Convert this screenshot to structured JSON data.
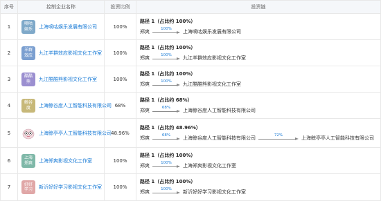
{
  "headers": {
    "index": "序号",
    "company": "控制企业名称",
    "ratio": "投资比例",
    "chain": "投资链"
  },
  "rows": [
    {
      "index": "1",
      "logo_text": "嘀咕\n娱乐",
      "logo_color": "#7fa9c9",
      "company": "上海嘀咕娱乐发展有限公司",
      "ratio": "100%",
      "path_title": "路径 1（占比约 100%）",
      "chain": [
        {
          "node": "郑爽"
        },
        {
          "pct": "100%"
        },
        {
          "node": "上海嘀咕娱乐发展有限公司"
        }
      ]
    },
    {
      "index": "2",
      "logo_text": "羊群\n效应",
      "logo_color": "#7b9fd0",
      "company": "九江羊群效应影视文化工作室",
      "ratio": "100%",
      "path_title": "路径 1（占比约 100%）",
      "chain": [
        {
          "node": "郑爽"
        },
        {
          "pct": "100%"
        },
        {
          "node": "九江羊群效应影视文化工作室"
        }
      ]
    },
    {
      "index": "3",
      "logo_text": "酷酷\n熊",
      "logo_color": "#9b8fd0",
      "company": "九江酷酷熊影视文化工作室",
      "ratio": "100%",
      "path_title": "路径 1（占比约 100%）",
      "chain": [
        {
          "node": "郑爽"
        },
        {
          "pct": "100%"
        },
        {
          "node": "九江酷酷熊影视文化工作室"
        }
      ]
    },
    {
      "index": "4",
      "logo_text": "鲸谷\n度",
      "logo_color": "#c7b879",
      "company": "上海鲸谷度人工智能科技有限公司",
      "ratio": "68%",
      "path_title": "路径 1（占比约 68%）",
      "chain": [
        {
          "node": "郑爽"
        },
        {
          "pct": "68%"
        },
        {
          "node": "上海鲸谷度人工智能科技有限公司"
        }
      ]
    },
    {
      "index": "5",
      "logo_text": "",
      "logo_color": "#ffffff",
      "company": "上海鲸亭亭人工智能科技有限公司",
      "ratio": "48.96%",
      "path_title": "路径 1（占比约 48.96%）",
      "chain": [
        {
          "node": "郑爽"
        },
        {
          "pct": "68%"
        },
        {
          "node": "上海鲸谷度人工智能科技有限公司"
        },
        {
          "pct": "72%"
        },
        {
          "node": "上海鲸亭亭人工智能科技有限公司"
        }
      ]
    },
    {
      "index": "6",
      "logo_text": "上海\n郑爽",
      "logo_color": "#7fb8a8",
      "company": "上海郑爽影视文化工作室",
      "ratio": "100%",
      "path_title": "路径 1（占比约 100%）",
      "chain": [
        {
          "node": "郑爽"
        },
        {
          "pct": "100%"
        },
        {
          "node": "上海郑爽影视文化工作室"
        }
      ]
    },
    {
      "index": "7",
      "logo_text": "好好\n学习",
      "logo_color": "#e0a7a7",
      "company": "新沂好好学习影视文化工作室",
      "ratio": "100%",
      "path_title": "路径 1（占比约 100%）",
      "chain": [
        {
          "node": "郑爽"
        },
        {
          "pct": "100%"
        },
        {
          "node": "新沂好好学习影视文化工作室"
        }
      ]
    }
  ]
}
